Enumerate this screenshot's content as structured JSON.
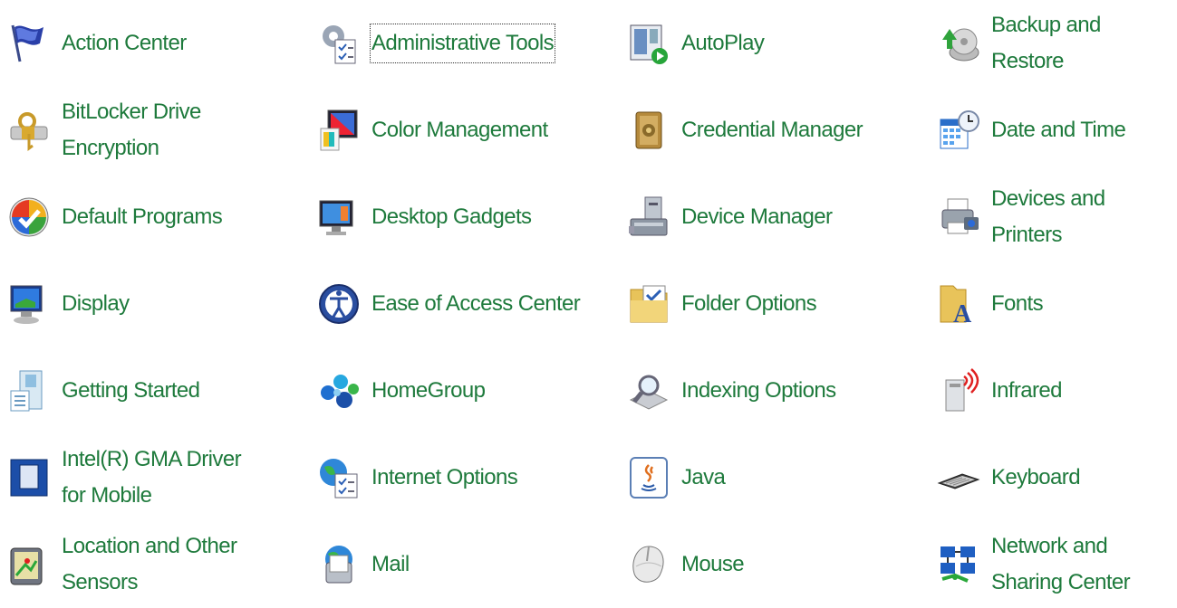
{
  "accent_color": "#1e7a3c",
  "items": [
    {
      "label": "Action Center",
      "icon": "flag-icon"
    },
    {
      "label": "Administrative Tools",
      "icon": "admin-tools-icon"
    },
    {
      "label": "AutoPlay",
      "icon": "autoplay-icon"
    },
    {
      "label": "Backup and Restore",
      "icon": "backup-icon"
    },
    {
      "label": "BitLocker Drive Encryption",
      "icon": "bitlocker-icon"
    },
    {
      "label": "Color Management",
      "icon": "color-management-icon"
    },
    {
      "label": "Credential Manager",
      "icon": "vault-icon"
    },
    {
      "label": "Date and Time",
      "icon": "calendar-clock-icon"
    },
    {
      "label": "Default Programs",
      "icon": "default-programs-icon"
    },
    {
      "label": "Desktop Gadgets",
      "icon": "gadgets-icon"
    },
    {
      "label": "Device Manager",
      "icon": "device-manager-icon"
    },
    {
      "label": "Devices and Printers",
      "icon": "printer-icon"
    },
    {
      "label": "Display",
      "icon": "display-icon"
    },
    {
      "label": "Ease of Access Center",
      "icon": "ease-of-access-icon"
    },
    {
      "label": "Folder Options",
      "icon": "folder-options-icon"
    },
    {
      "label": "Fonts",
      "icon": "fonts-icon"
    },
    {
      "label": "Getting Started",
      "icon": "getting-started-icon"
    },
    {
      "label": "HomeGroup",
      "icon": "homegroup-icon"
    },
    {
      "label": "Indexing Options",
      "icon": "indexing-icon"
    },
    {
      "label": "Infrared",
      "icon": "infrared-icon"
    },
    {
      "label": "Intel(R) GMA Driver for Mobile",
      "icon": "intel-gma-icon"
    },
    {
      "label": "Internet Options",
      "icon": "internet-options-icon"
    },
    {
      "label": "Java",
      "icon": "java-icon"
    },
    {
      "label": "Keyboard",
      "icon": "keyboard-icon"
    },
    {
      "label": "Location and Other Sensors",
      "icon": "location-sensors-icon"
    },
    {
      "label": "Mail",
      "icon": "mail-icon"
    },
    {
      "label": "Mouse",
      "icon": "mouse-icon"
    },
    {
      "label": "Network and Sharing Center",
      "icon": "network-icon"
    }
  ]
}
